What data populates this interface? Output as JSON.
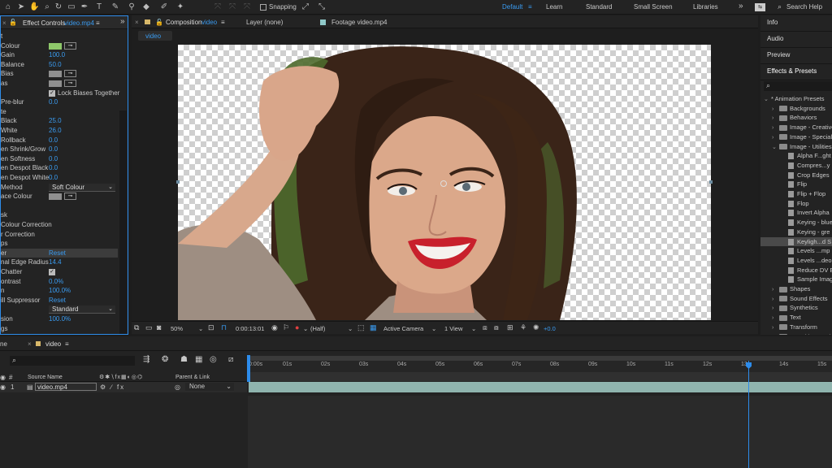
{
  "toolbar": {
    "snapping_label": "Snapping",
    "workspaces": [
      "Default",
      "Learn",
      "Standard",
      "Small Screen",
      "Libraries"
    ],
    "overflow": "»",
    "search_placeholder": "Search Help"
  },
  "effect_controls": {
    "tab_prefix": "Effect Controls",
    "tab_layer": "video.mp4",
    "tab_menu": "≡",
    "overflow": "»",
    "rows": [
      {
        "label": "t",
        "kind": "none"
      },
      {
        "label": "Colour",
        "kind": "swatch",
        "color": "#8ec86a"
      },
      {
        "label": "Gain",
        "kind": "value",
        "value": "100.0"
      },
      {
        "label": "Balance",
        "kind": "value",
        "value": "50.0"
      },
      {
        "label": "Bias",
        "kind": "swatch",
        "color": "#8f8f8f"
      },
      {
        "label": "as",
        "kind": "swatch",
        "color": "#8f8f8f"
      },
      {
        "label": "",
        "kind": "check",
        "value": "Lock Biases Together"
      },
      {
        "label": "Pre-blur",
        "kind": "value",
        "value": "0.0"
      },
      {
        "label": "te",
        "kind": "none"
      },
      {
        "label": "Black",
        "kind": "value",
        "value": "25.0"
      },
      {
        "label": "White",
        "kind": "value",
        "value": "26.0"
      },
      {
        "label": "Rollback",
        "kind": "value",
        "value": "0.0"
      },
      {
        "label": "en Shrink/Grow",
        "kind": "value",
        "value": "0.0"
      },
      {
        "label": "en Softness",
        "kind": "value",
        "value": "0.0"
      },
      {
        "label": "en Despot Black",
        "kind": "value",
        "value": "0.0"
      },
      {
        "label": "en Despot White",
        "kind": "value",
        "value": "0.0"
      },
      {
        "label": "Method",
        "kind": "dropdown",
        "value": "Soft Colour"
      },
      {
        "label": "ace Colour",
        "kind": "swatch",
        "color": "#8f8f8f"
      },
      {
        "label": "",
        "kind": "none"
      },
      {
        "label": "sk",
        "kind": "none"
      },
      {
        "label": "Colour Correction",
        "kind": "none"
      },
      {
        "label": "r Correction",
        "kind": "none"
      },
      {
        "label": "ps",
        "kind": "none"
      },
      {
        "label": "er",
        "kind": "reset",
        "value": "Reset"
      },
      {
        "label": "nal Edge Radius",
        "kind": "value",
        "value": "14.4"
      },
      {
        "label": "Chatter",
        "kind": "checkonly"
      },
      {
        "label": "ontrast",
        "kind": "value",
        "value": "0.0%"
      },
      {
        "label": "n",
        "kind": "value",
        "value": "100.0%"
      },
      {
        "label": "ill Suppressor",
        "kind": "reset",
        "value": "Reset"
      },
      {
        "label": "",
        "kind": "dropdown",
        "value": "Standard"
      },
      {
        "label": "sion",
        "kind": "value",
        "value": "100.0%"
      },
      {
        "label": "gs",
        "kind": "none"
      }
    ]
  },
  "composition": {
    "tab_prefix": "Composition",
    "tab_name": "video",
    "tab_menu": "≡",
    "layer_tab": "Layer (none)",
    "footage_tab": "Footage video.mp4",
    "sub_tab": "video",
    "footer": {
      "zoom": "50%",
      "timecode": "0:00:13:01",
      "resolution": "(Half)",
      "camera": "Active Camera",
      "views": "1 View",
      "exposure": "+0.0"
    }
  },
  "right_panel": {
    "sections": [
      "Info",
      "Audio",
      "Preview",
      "Effects & Presets"
    ],
    "search_icon": "⌕",
    "tree": [
      {
        "text": "* Animation Presets",
        "kind": "root"
      },
      {
        "text": "Backgrounds",
        "kind": "folder"
      },
      {
        "text": "Behaviors",
        "kind": "folder"
      },
      {
        "text": "Image - Creative",
        "kind": "folder"
      },
      {
        "text": "Image - Special",
        "kind": "folder"
      },
      {
        "text": "Image - Utilities",
        "kind": "folder-open"
      },
      {
        "text": "Alpha F...ght",
        "kind": "preset"
      },
      {
        "text": "Compres...y",
        "kind": "preset"
      },
      {
        "text": "Crop Edges",
        "kind": "preset"
      },
      {
        "text": "Flip",
        "kind": "preset"
      },
      {
        "text": "Flip + Flop",
        "kind": "preset"
      },
      {
        "text": "Flop",
        "kind": "preset"
      },
      {
        "text": "Invert Alpha",
        "kind": "preset"
      },
      {
        "text": "Keying - blue",
        "kind": "preset"
      },
      {
        "text": "Keying - gre",
        "kind": "preset"
      },
      {
        "text": "Keyligh...d S",
        "kind": "preset-selected"
      },
      {
        "text": "Levels ...mp",
        "kind": "preset"
      },
      {
        "text": "Levels ...deo",
        "kind": "preset"
      },
      {
        "text": "Reduce DV E",
        "kind": "preset"
      },
      {
        "text": "Sample Imag",
        "kind": "preset"
      },
      {
        "text": "Shapes",
        "kind": "folder"
      },
      {
        "text": "Sound Effects",
        "kind": "folder"
      },
      {
        "text": "Synthetics",
        "kind": "folder"
      },
      {
        "text": "Text",
        "kind": "folder"
      },
      {
        "text": "Transform",
        "kind": "folder"
      },
      {
        "text": "Transitions - Dis",
        "kind": "folder"
      }
    ]
  },
  "timeline": {
    "tab_prefix": "ne",
    "comp_tab": "video",
    "tab_menu": "≡",
    "col_num": "#",
    "col_source": "Source Name",
    "col_parent": "Parent & Link",
    "layer_num": "1",
    "layer_name": "video.mp4",
    "parent_value": "None",
    "ticks": [
      "0:00s",
      "01s",
      "02s",
      "03s",
      "04s",
      "05s",
      "06s",
      "07s",
      "08s",
      "09s",
      "10s",
      "11s",
      "12s",
      "13s",
      "14s",
      "15s"
    ]
  },
  "colors": {
    "accent": "#2d8ceb",
    "value_blue": "#3a9bf0",
    "panel_bg": "#232323",
    "clip_bar": "#8fb4ae"
  }
}
